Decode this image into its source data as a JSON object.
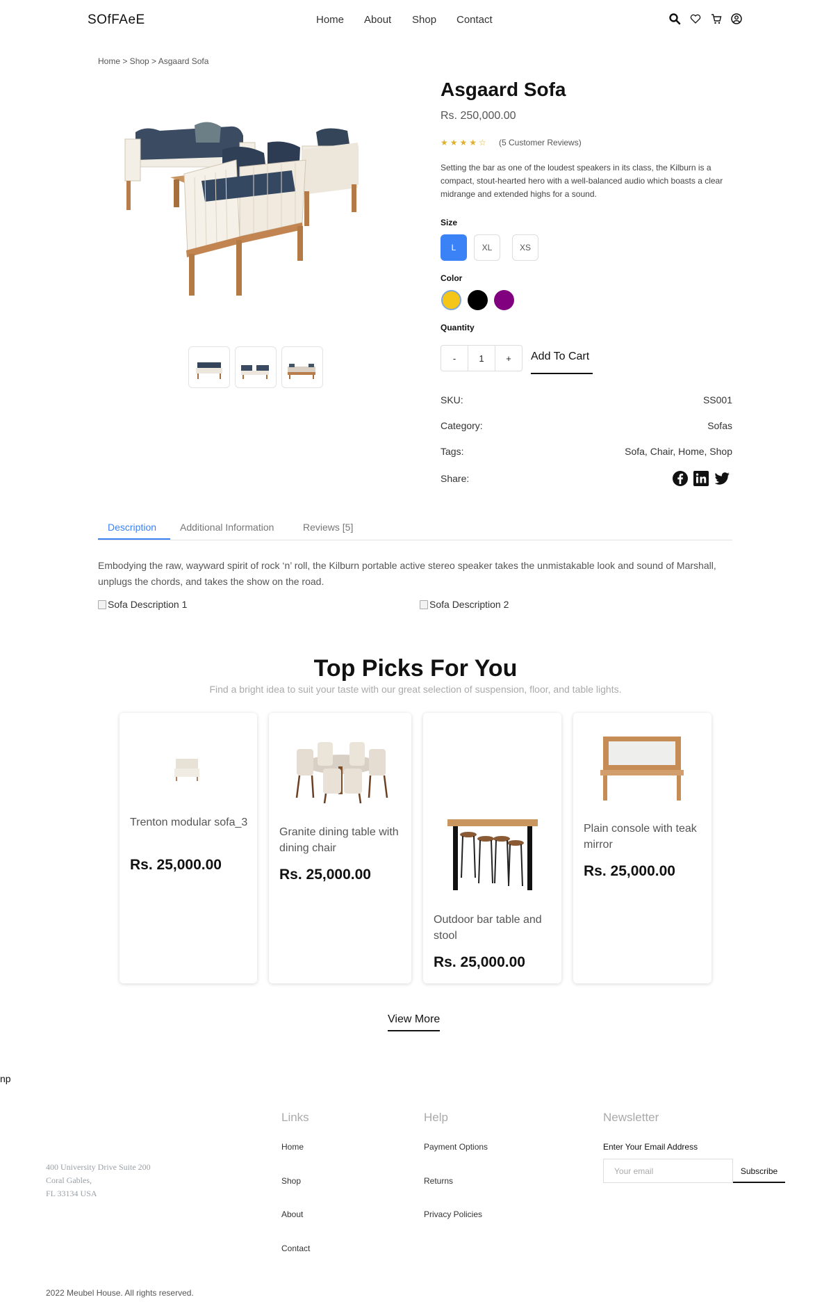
{
  "header": {
    "logo": "SOfFAeE",
    "nav": [
      "Home",
      "About",
      "Shop",
      "Contact"
    ],
    "icons": [
      "search-icon",
      "heart-icon",
      "cart-icon",
      "user-icon"
    ]
  },
  "breadcrumb": "Home > Shop > Asgaard Sofa",
  "product": {
    "title": "Asgaard Sofa",
    "price": "Rs. 250,000.00",
    "rating": 4.5,
    "stars": "★★★★☆",
    "reviews_label": "(5 Customer Reviews)",
    "description": "Setting the bar as one of the loudest speakers in its class, the Kilburn is a compact, stout-hearted hero with a well-balanced audio which boasts a clear midrange and extended highs for a sound.",
    "size_label": "Size",
    "sizes": [
      "L",
      "XL",
      "XS"
    ],
    "selected_size": "L",
    "color_label": "Color",
    "colors": [
      "#f5c518",
      "#000000",
      "#800080"
    ],
    "quantity_label": "Quantity",
    "qty_minus": "-",
    "qty_value": "1",
    "qty_plus": "+",
    "add_to_cart": "Add To Cart",
    "meta": [
      {
        "label": "SKU:",
        "value": "SS001"
      },
      {
        "label": "Category:",
        "value": "Sofas"
      },
      {
        "label": "Tags:",
        "value": "Sofa, Chair, Home, Shop"
      },
      {
        "label": "Share:",
        "value": ""
      }
    ],
    "share_icons": [
      "facebook-icon",
      "linkedin-icon",
      "twitter-icon"
    ]
  },
  "tabs": {
    "items": [
      "Description",
      "Additional Information",
      "Reviews [5]"
    ],
    "active": "Description",
    "description": "Embodying the raw, wayward spirit of rock ‘n’ roll, the Kilburn portable active stereo speaker takes the unmistakable look and sound of Marshall, unplugs the chords, and takes the show on the road.",
    "image_alts": [
      "Sofa Description 1",
      "Sofa Description 2"
    ]
  },
  "top_picks": {
    "title": "Top Picks For You",
    "subtitle": "Find a bright idea to suit your taste with our great selection of suspension, floor, and table lights.",
    "cards": [
      {
        "name": "Trenton modular sofa_3",
        "price": "Rs. 25,000.00"
      },
      {
        "name": "Granite dining table with dining chair",
        "price": "Rs. 25,000.00"
      },
      {
        "name": "Outdoor bar table and stool",
        "price": "Rs. 25,000.00"
      },
      {
        "name": "Plain console with teak mirror",
        "price": "Rs. 25,000.00"
      }
    ],
    "view_more": "View More"
  },
  "stray_text": "np",
  "footer": {
    "address": [
      "400 University Drive Suite 200",
      "Coral Gables,",
      "FL 33134 USA"
    ],
    "links_title": "Links",
    "links": [
      "Home",
      "Shop",
      "About",
      "Contact"
    ],
    "help_title": "Help",
    "help": [
      "Payment Options",
      "Returns",
      "Privacy Policies"
    ],
    "newsletter_title": "Newsletter",
    "newsletter_label": "Enter Your Email Address",
    "email_placeholder": "Your email",
    "subscribe": "Subscribe",
    "copyright": "2022 Meubel House. All rights reserved."
  }
}
